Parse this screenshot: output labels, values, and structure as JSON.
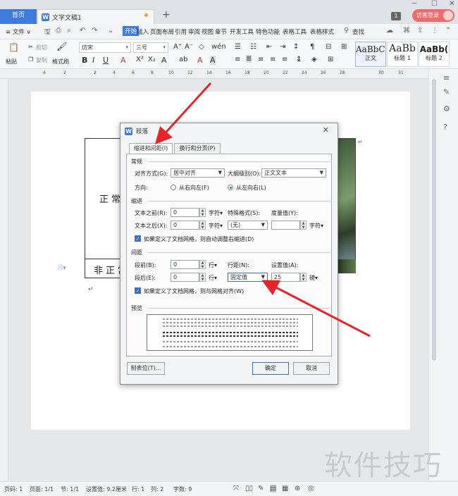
{
  "titlebar": {
    "home_tab": "首页",
    "doc_tab": "文字文稿1",
    "new_tab": "+",
    "window_count": "1",
    "login": "访客登录"
  },
  "menu": {
    "file": "≡ 文件 ∨",
    "items": [
      "开始",
      "插入",
      "页面布局",
      "引用",
      "审阅",
      "视图",
      "章节",
      "开发工具",
      "特色功能",
      "表格工具",
      "表格样式"
    ],
    "search": "查找"
  },
  "ribbon": {
    "paste": "粘贴",
    "cut": "剪切",
    "copy": "复制",
    "format_painter": "格式刷",
    "font_name": "仿宋",
    "font_size": "三号",
    "styles": [
      {
        "preview": "AaBbCc",
        "name": "正文"
      },
      {
        "preview": "AaBb",
        "name": "标题 1"
      },
      {
        "preview": "AaBb(",
        "name": "标题 2"
      }
    ]
  },
  "ruler": {
    "numbers": [
      "4",
      "2",
      "2",
      "4",
      "6",
      "8",
      "10",
      "12",
      "14",
      "16",
      "18",
      "20",
      "22",
      "24",
      "26",
      "28",
      "30",
      "31"
    ]
  },
  "document": {
    "cell_top": "正常",
    "cell_bottom": "非正常"
  },
  "dialog": {
    "title": "段落",
    "tabs": [
      "缩进和间距(I)",
      "换行和分页(P)"
    ],
    "general": {
      "heading": "常规",
      "align_label": "对齐方式(G):",
      "align_value": "居中对齐",
      "outline_label": "大纲级别(O):",
      "outline_value": "正文文本",
      "direction_label": "方向:",
      "rtl": "从右向左(F)",
      "ltr": "从左向右(L)"
    },
    "indent": {
      "heading": "缩进",
      "before_label": "文本之前(R):",
      "before_value": "0",
      "before_unit": "字符▾",
      "after_label": "文本之后(X):",
      "after_value": "0",
      "after_unit": "字符▾",
      "special_label": "特殊格式(S):",
      "special_value": "(无)",
      "measure_label": "度量值(Y):",
      "measure_unit": "字符▾",
      "auto_adjust": "如果定义了文档网格，则自动调整右缩进(D)"
    },
    "spacing": {
      "heading": "间距",
      "before_label": "段前(B):",
      "before_value": "0",
      "before_unit": "行▾",
      "after_label": "段后(E):",
      "after_value": "0",
      "after_unit": "行▾",
      "line_label": "行距(N):",
      "line_value": "固定值",
      "set_label": "设置值(A):",
      "set_value": "25",
      "set_unit": "磅▾",
      "snap_grid": "如果定义了文档网格，则与网格对齐(W)"
    },
    "preview_heading": "预览",
    "buttons": {
      "tabs": "制表位(T)...",
      "ok": "确定",
      "cancel": "取消"
    }
  },
  "status": {
    "page_no": "页码: 1",
    "pages": "页面: 1/1",
    "section": "节: 1/1",
    "setting": "设置值: 9.2厘米",
    "row": "行: 1",
    "col": "列: 2",
    "words": "字数: 9"
  },
  "watermark": "软件技巧"
}
